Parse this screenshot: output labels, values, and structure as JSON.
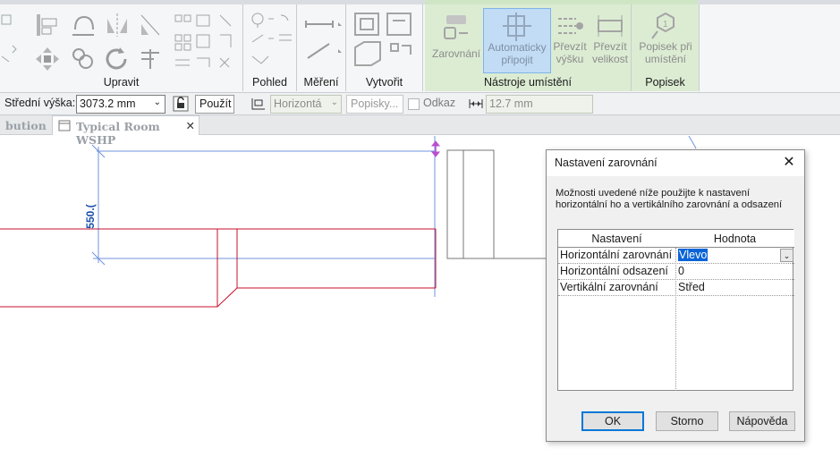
{
  "ribbon": {
    "panels": {
      "upravit": "Upravit",
      "pohled": "Pohled",
      "mereni": "Měření",
      "vytvorit": "Vytvořit",
      "nastroje": "Nástroje umístění",
      "popisek": "Popisek"
    },
    "buttons": {
      "zarovnani": "Zarovnání",
      "auto_line1": "Automaticky",
      "auto_line2": "připojit",
      "prevzit_vysku_1": "Převzít",
      "prevzit_vysku_2": "výšku",
      "prevzit_velikost_1": "Převzít",
      "prevzit_velikost_2": "velikost",
      "popisek_1": "Popisek při",
      "popisek_2": "umístění"
    }
  },
  "options_bar": {
    "stredni_vyska_label": "Střední výška:",
    "stredni_vyska_value": "3073.2 mm",
    "pouzit": "Použít",
    "orientation": "Horizontá",
    "popisky": "Popisky...",
    "odkaz": "Odkaz",
    "length_value": "12.7 mm"
  },
  "tabs": {
    "prev": "bution",
    "active": "Typical Room WSHP"
  },
  "canvas": {
    "dimension_label": "550.("
  },
  "dialog": {
    "title": "Nastavení zarovnání",
    "description": "Možnosti uvedené níže použijte k nastavení horizontální ho a vertikálního zarovnání a odsazení",
    "grid": {
      "headers": [
        "Nastavení",
        "Hodnota"
      ],
      "rows": [
        {
          "name": "Horizontální zarovnání",
          "value": "Vlevo"
        },
        {
          "name": "Horizontální odsazení",
          "value": "0"
        },
        {
          "name": "Vertikální zarovnání",
          "value": "Střed"
        }
      ]
    },
    "buttons": {
      "ok": "OK",
      "storno": "Storno",
      "napoveda": "Nápověda"
    }
  },
  "colors": {
    "duct_red": "#c8102e",
    "dim_blue": "#4f7fd9",
    "grip_purple": "#b84fd0",
    "dialog_selection": "#0a64d7"
  }
}
